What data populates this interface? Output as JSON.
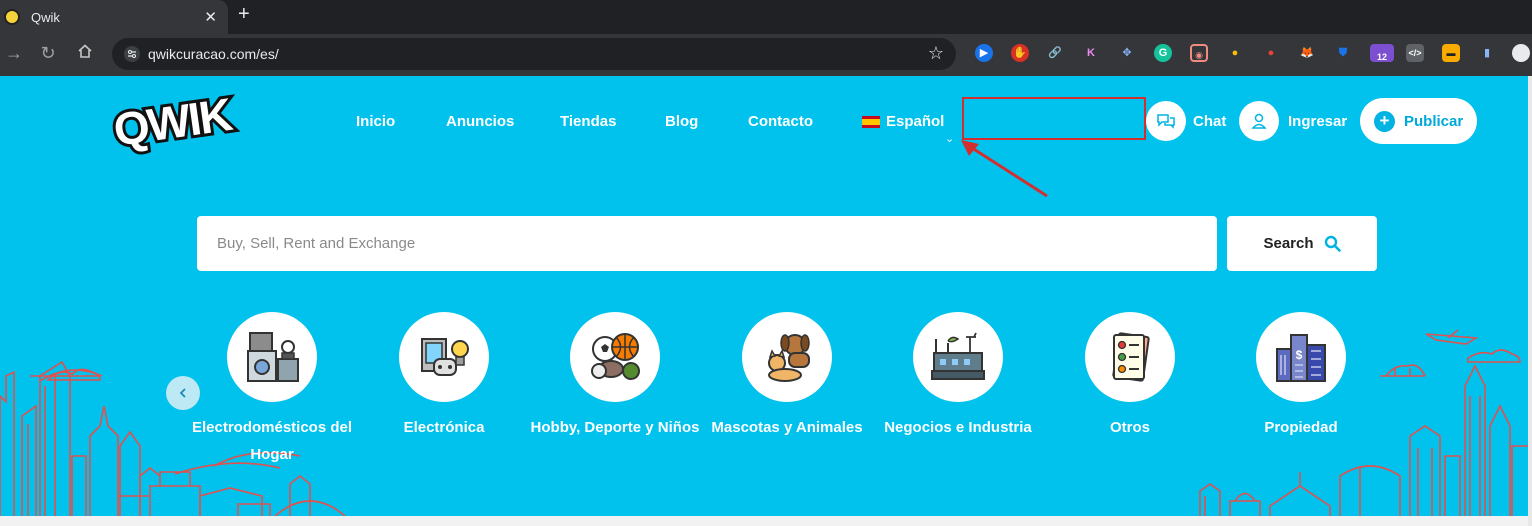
{
  "browser": {
    "tab_title": "Qwik",
    "tab_close": "✕",
    "new_tab": "+",
    "url": "qwikcuracao.com/es/",
    "extension_badge": "12"
  },
  "header": {
    "logo_text": "QWIK",
    "nav": [
      "Inicio",
      "Anuncios",
      "Tiendas",
      "Blog",
      "Contacto"
    ],
    "language": "Español",
    "chat_label": "Chat",
    "login_label": "Ingresar",
    "publish_label": "Publicar"
  },
  "search": {
    "placeholder": "Buy, Sell, Rent and Exchange",
    "button_label": "Search"
  },
  "categories": [
    {
      "label": "Electrodomésticos del Hogar",
      "icon": "appliances-icon"
    },
    {
      "label": "Electrónica",
      "icon": "electronics-icon"
    },
    {
      "label": "Hobby, Deporte y Niños",
      "icon": "sports-balls-icon"
    },
    {
      "label": "Mascotas y Animales",
      "icon": "pets-icon"
    },
    {
      "label": "Negocios e Industria",
      "icon": "industry-icon"
    },
    {
      "label": "Otros",
      "icon": "checklist-icon"
    },
    {
      "label": "Propiedad",
      "icon": "buildings-icon"
    }
  ],
  "colors": {
    "page_background": "#00c2ed",
    "accent": "#00b3e3",
    "skyline": "#e0524f",
    "annotation": "#d32f2f"
  }
}
